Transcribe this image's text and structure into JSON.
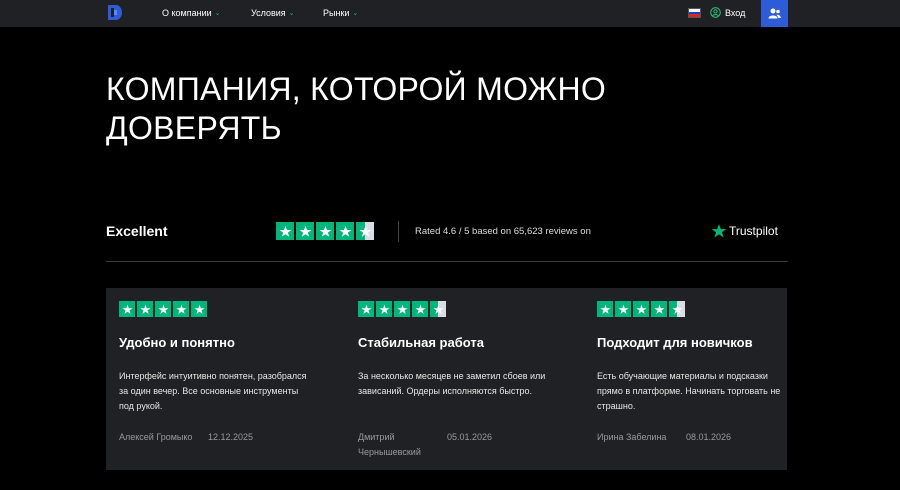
{
  "nav": {
    "items": [
      {
        "label": "О компании"
      },
      {
        "label": "Условия"
      },
      {
        "label": "Рынки"
      }
    ],
    "login_label": "Вход"
  },
  "hero": {
    "title": "КОМПАНИЯ, КОТОРОЙ МОЖНО ДОВЕРЯТЬ"
  },
  "rating": {
    "label": "Excellent",
    "summary": "Rated 4.6 / 5 based on 65,623 reviews on",
    "score": 4.5,
    "provider": "Trustpilot"
  },
  "reviews": [
    {
      "title": "Удобно и понятно",
      "text": "Интерфейс интуитивно понятен, разобрался за один вечер. Все основные инструменты под рукой.",
      "author": "Алексей Громыко",
      "date": "12.12.2025",
      "stars": 5
    },
    {
      "title": "Стабильная работа",
      "text": "За несколько месяцев не заметил сбоев или зависаний. Ордеры исполняются быстро.",
      "author": "Дмитрий Чернышевский",
      "date": "05.01.2026",
      "stars": 4.5
    },
    {
      "title": "Подходит для новичков",
      "text": "Есть обучающие материалы и подсказки прямо в платформе. Начинать торговать не страшно.",
      "author": "Ирина Забелина",
      "date": "08.01.2026",
      "stars": 4.5
    }
  ],
  "colors": {
    "trustpilot_green": "#00b67a",
    "nav_bg": "#202124",
    "accent_blue": "#2e5bd8"
  }
}
